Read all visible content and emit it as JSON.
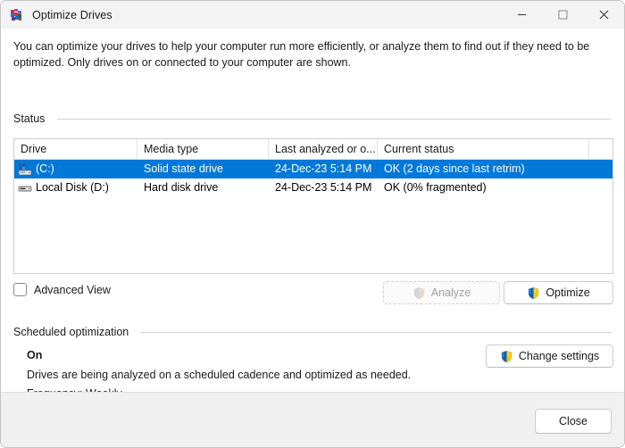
{
  "window": {
    "title": "Optimize Drives",
    "app_icon": "defrag-icon",
    "controls": {
      "minimize": "minimize-icon",
      "maximize": "maximize-icon",
      "close": "close-icon"
    },
    "accent_color": "#0078d7",
    "titlebar_color": "#f3f3f3",
    "footer_color": "#f0f0f0"
  },
  "intro_text": "You can optimize your drives to help your computer run more efficiently, or analyze them to find out if they need to be optimized. Only drives on or connected to your computer are shown.",
  "status_section": {
    "header": "Status",
    "columns": [
      "Drive",
      "Media type",
      "Last analyzed or o...",
      "Current status"
    ],
    "rows": [
      {
        "icon": "system-drive-icon",
        "drive": "(C:)",
        "media_type": "Solid state drive",
        "last_analyzed": "24-Dec-23 5:14 PM",
        "current_status": "OK (2 days since last retrim)",
        "selected": true
      },
      {
        "icon": "hard-disk-icon",
        "drive": "Local Disk (D:)",
        "media_type": "Hard disk drive",
        "last_analyzed": "24-Dec-23 5:14 PM",
        "current_status": "OK (0% fragmented)",
        "selected": false
      }
    ]
  },
  "advanced_view": {
    "label": "Advanced View",
    "checked": false
  },
  "actions": {
    "analyze_label": "Analyze",
    "analyze_enabled": false,
    "optimize_label": "Optimize",
    "optimize_enabled": true
  },
  "scheduled_section": {
    "header": "Scheduled optimization",
    "state": "On",
    "description": "Drives are being analyzed on a scheduled cadence and optimized as needed.",
    "frequency": "Frequency: Weekly",
    "change_settings_label": "Change settings"
  },
  "footer": {
    "close_label": "Close"
  }
}
